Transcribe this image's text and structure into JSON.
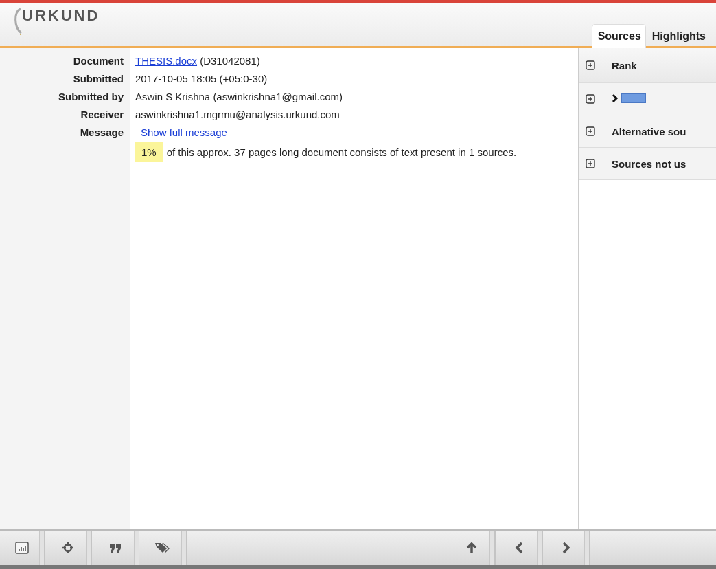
{
  "header": {
    "logo": "URKUND"
  },
  "tabs": [
    {
      "label": "Sources",
      "selected": true
    },
    {
      "label": "Highlights",
      "selected": false
    }
  ],
  "details": [
    {
      "label": "Document",
      "kind": "link",
      "link": "THESIS.docx",
      "text": "(D31042081)"
    },
    {
      "label": "Submitted",
      "kind": "text",
      "text": "2017-10-05 18:05 (+05:0-30)"
    },
    {
      "label": "Submitted by",
      "kind": "text",
      "text": "Aswin S Krishna (aswinkrishna1@gmail.com)"
    },
    {
      "label": "Receiver",
      "kind": "text",
      "text": "aswinkrishna1.mgrmu@analysis.urkund.com"
    },
    {
      "label": "Message",
      "kind": "action",
      "link": "Show full message"
    }
  ],
  "summary": {
    "percent": "1%",
    "text": "of this approx. 37 pages long document consists of text present in 1 sources."
  },
  "sources": [
    {
      "kind": "header",
      "label": "Rank"
    },
    {
      "kind": "source"
    },
    {
      "kind": "group",
      "label": "Alternative sou"
    },
    {
      "kind": "group",
      "label": "Sources not us"
    }
  ]
}
